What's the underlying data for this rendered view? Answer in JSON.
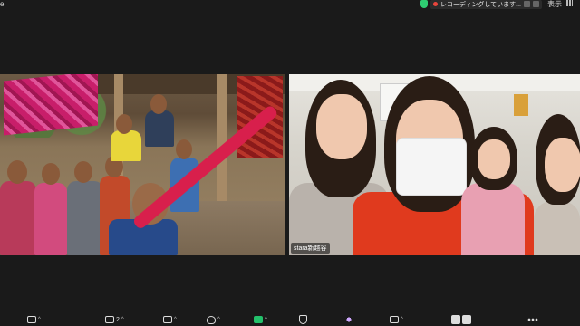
{
  "window": {
    "app_title": "e"
  },
  "topbar": {
    "recording_label": "レコーディングしています...",
    "display_label": "表示"
  },
  "participants": [
    {
      "id": "left",
      "name": ""
    },
    {
      "id": "right",
      "name": "stara新越谷"
    }
  ],
  "toolbar": {
    "participants_count": "2",
    "icons": [
      "video-icon",
      "participants-icon",
      "chat-icon",
      "react-icon",
      "share-screen-icon",
      "security-icon",
      "ai-companion-icon",
      "apps-icon",
      "pause-recording-icon",
      "stop-recording-icon",
      "more-icon"
    ]
  },
  "colors": {
    "share_green": "#23c16b",
    "rec_red": "#e8453c",
    "secure_green": "#2ecc71"
  }
}
